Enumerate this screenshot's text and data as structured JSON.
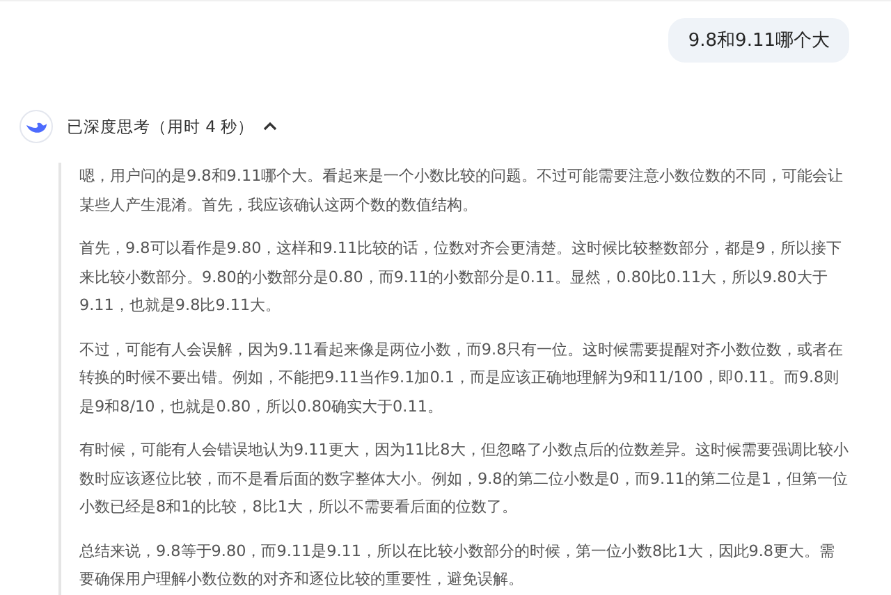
{
  "user_message": "9.8和9.11哪个大",
  "thinking": {
    "label": "已深度思考（用时 4 秒）",
    "expanded": true,
    "paragraphs": [
      "嗯，用户问的是9.8和9.11哪个大。看起来是一个小数比较的问题。不过可能需要注意小数位数的不同，可能会让某些人产生混淆。首先，我应该确认这两个数的数值结构。",
      "首先，9.8可以看作是9.80，这样和9.11比较的话，位数对齐会更清楚。这时候比较整数部分，都是9，所以接下来比较小数部分。9.80的小数部分是0.80，而9.11的小数部分是0.11。显然，0.80比0.11大，所以9.80大于9.11，也就是9.8比9.11大。",
      "不过，可能有人会误解，因为9.11看起来像是两位小数，而9.8只有一位。这时候需要提醒对齐小数位数，或者在转换的时候不要出错。例如，不能把9.11当作9.1加0.1，而是应该正确地理解为9和11/100，即0.11。而9.8则是9和8/10，也就是0.80，所以0.80确实大于0.11。",
      "有时候，可能有人会错误地认为9.11更大，因为11比8大，但忽略了小数点后的位数差异。这时候需要强调比较小数时应该逐位比较，而不是看后面的数字整体大小。例如，9.8的第二位小数是0，而9.11的第二位是1，但第一位小数已经是8和1的比较，8比1大，所以不需要看后面的位数了。",
      "总结来说，9.8等于9.80，而9.11是9.11，所以在比较小数部分的时候，第一位小数8比1大，因此9.8更大。需要确保用户理解小数位数的对齐和逐位比较的重要性，避免误解。"
    ]
  }
}
